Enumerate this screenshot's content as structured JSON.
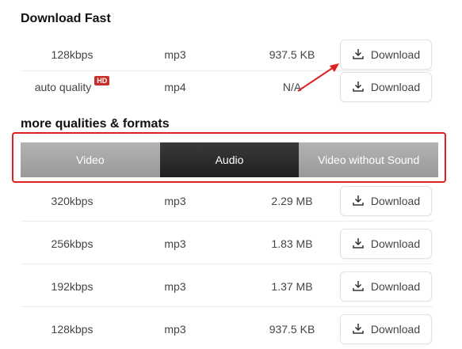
{
  "fast": {
    "title": "Download Fast",
    "rows": [
      {
        "quality": "128kbps",
        "format": "mp3",
        "size": "937.5 KB",
        "button": "Download"
      },
      {
        "quality": "auto quality",
        "badge": "HD",
        "format": "mp4",
        "size": "N/A",
        "button": "Download"
      }
    ]
  },
  "more": {
    "title": "more qualities & formats",
    "tabs": [
      {
        "label": "Video",
        "active": false
      },
      {
        "label": "Audio",
        "active": true
      },
      {
        "label": "Video without Sound",
        "active": false
      }
    ],
    "rows": [
      {
        "quality": "320kbps",
        "format": "mp3",
        "size": "2.29 MB",
        "button": "Download"
      },
      {
        "quality": "256kbps",
        "format": "mp3",
        "size": "1.83 MB",
        "button": "Download"
      },
      {
        "quality": "192kbps",
        "format": "mp3",
        "size": "1.37 MB",
        "button": "Download"
      },
      {
        "quality": "128kbps",
        "format": "mp3",
        "size": "937.5 KB",
        "button": "Download"
      }
    ]
  },
  "colors": {
    "highlight": "#e02020",
    "active_tab": "#2b2b2b",
    "inactive_tab": "#a8a8a8",
    "badge": "#c9302c"
  },
  "icons": {
    "download": "download-icon",
    "arrow": "red-arrow-annotation"
  }
}
